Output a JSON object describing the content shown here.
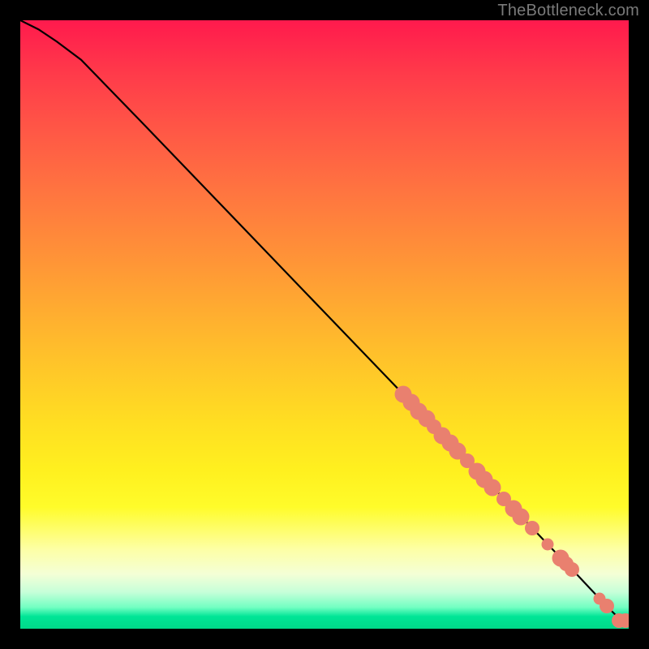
{
  "watermark": "TheBottleneck.com",
  "colors": {
    "dot": "#e9806f",
    "curve": "#000000",
    "page_bg": "#000000"
  },
  "chart_data": {
    "type": "line",
    "title": "",
    "xlabel": "",
    "ylabel": "",
    "xlim": [
      0,
      100
    ],
    "ylim": [
      0,
      100
    ],
    "grid": false,
    "legend": false,
    "series": [
      {
        "name": "curve",
        "x": [
          0,
          3,
          6,
          10,
          20,
          30,
          40,
          50,
          60,
          65,
          70,
          74,
          78,
          81,
          84,
          86,
          88,
          90,
          91.5,
          93,
          94.5,
          96,
          97,
          98,
          99,
          100
        ],
        "y": [
          100,
          98.5,
          96.5,
          93.5,
          83.2,
          72.8,
          62.4,
          52.0,
          41.6,
          36.4,
          31.2,
          27.0,
          22.9,
          19.8,
          16.7,
          14.6,
          12.5,
          10.4,
          8.9,
          7.3,
          5.7,
          4.2,
          3.1,
          2.1,
          1.3,
          1.0
        ]
      }
    ],
    "markers": [
      {
        "x": 62.9,
        "y": 38.5,
        "r": 1.4
      },
      {
        "x": 64.2,
        "y": 37.2,
        "r": 1.4
      },
      {
        "x": 65.5,
        "y": 35.8,
        "r": 1.4
      },
      {
        "x": 66.8,
        "y": 34.5,
        "r": 1.4
      },
      {
        "x": 68.0,
        "y": 33.2,
        "r": 1.2
      },
      {
        "x": 69.3,
        "y": 31.8,
        "r": 1.4
      },
      {
        "x": 70.6,
        "y": 30.5,
        "r": 1.4
      },
      {
        "x": 71.9,
        "y": 29.2,
        "r": 1.4
      },
      {
        "x": 73.4,
        "y": 27.6,
        "r": 1.2
      },
      {
        "x": 75.0,
        "y": 25.9,
        "r": 1.4
      },
      {
        "x": 76.3,
        "y": 24.6,
        "r": 1.4
      },
      {
        "x": 77.6,
        "y": 23.2,
        "r": 1.4
      },
      {
        "x": 79.4,
        "y": 21.4,
        "r": 1.2
      },
      {
        "x": 81.0,
        "y": 19.7,
        "r": 1.4
      },
      {
        "x": 82.3,
        "y": 18.4,
        "r": 1.4
      },
      {
        "x": 84.1,
        "y": 16.5,
        "r": 1.2
      },
      {
        "x": 86.6,
        "y": 13.9,
        "r": 1.0
      },
      {
        "x": 88.8,
        "y": 11.6,
        "r": 1.4
      },
      {
        "x": 89.7,
        "y": 10.7,
        "r": 1.2
      },
      {
        "x": 90.6,
        "y": 9.7,
        "r": 1.2
      },
      {
        "x": 95.2,
        "y": 5.0,
        "r": 1.0
      },
      {
        "x": 96.4,
        "y": 3.7,
        "r": 1.2
      },
      {
        "x": 98.4,
        "y": 1.4,
        "r": 1.2
      },
      {
        "x": 99.5,
        "y": 1.4,
        "r": 1.2
      }
    ],
    "background_gradient_stops": [
      {
        "pct": 0,
        "color": "#ff1a4d"
      },
      {
        "pct": 48,
        "color": "#ffad30"
      },
      {
        "pct": 74,
        "color": "#fff01f"
      },
      {
        "pct": 94,
        "color": "#c6ffd9"
      },
      {
        "pct": 100,
        "color": "#00d889"
      }
    ]
  }
}
